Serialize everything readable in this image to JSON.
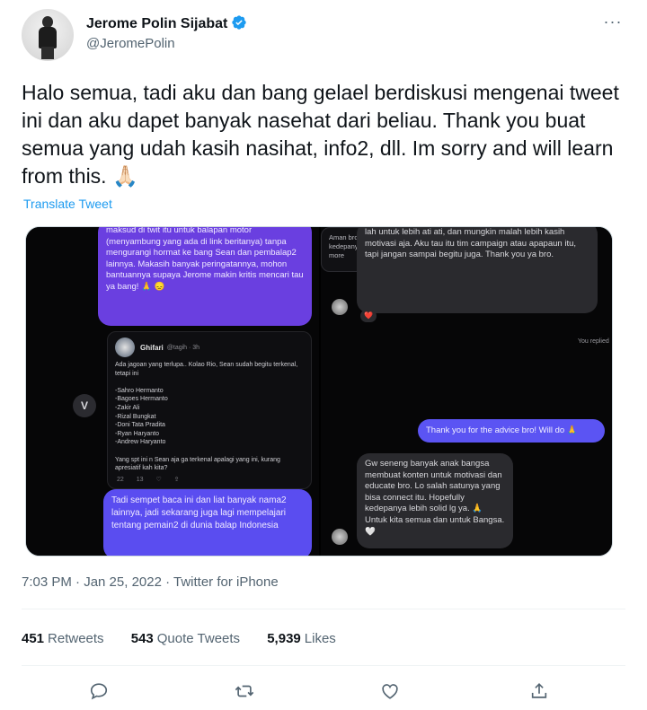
{
  "author": {
    "display_name": "Jerome Polin Sijabat",
    "handle": "@JeromePolin",
    "verified": true
  },
  "tweet": {
    "text": "Halo semua, tadi aku dan bang gelael berdiskusi mengenai tweet ini dan aku dapet banyak nasehat dari beliau. Thank you buat semua yang udah kasih nasihat, info2, dll. Im sorry and will learn from this. 🙏🏻",
    "translate_label": "Translate Tweet",
    "timestamp": "7:03 PM · Jan 25, 2022 · Twitter for iPhone"
  },
  "media": {
    "left": {
      "top_bubble": "maksud di twit itu untuk balapan motor (menyambung yang ada di link beritanya) tanpa mengurangi hormat ke bang Sean dan pembalap2 lainnya. Makasih banyak peringatannya, mohon bantuannya supaya Jerome makin kritis mencari tau ya bang! 🙏 😞",
      "v_icon_label": "V",
      "embedded_tweet": {
        "name": "Ghifari",
        "meta": "@tagih · 3h",
        "body": "Ada jagoan yang terlupa.. Kolao Rio, Sean sudah begitu terkenal, tetapi ini\n\n-Sahro Hermanto\n-Bagoes Hermanto\n-Zakir Ali\n-Rizal Bungkat\n-Doni Tata Pradita\n-Ryan Haryanto\n-Andrew Haryanto\n\nYang spt ini n Sean aja ga terkenal apalagi yang ini, kurang apresiatif kah kita?",
        "footer": "22 13 ♡ ⇪"
      },
      "bottom_bubble": "Tadi sempet baca ini dan liat banyak nama2 lainnya, jadi sekarang juga lagi mempelajari tentang pemain2 di dunia balap Indonesia"
    },
    "right": {
      "top_bubble": "lah untuk lebih ati ati, dan mungkin malah lebih kasih motivasi aja. Aku tau itu tim campaign atau apapaun itu, tapi jangan sampai begitu juga.\n\nThank you ya bro.",
      "reaction": "❤️",
      "replied_label": "You replied",
      "quoted_reply": "Aman bro, gw tau lo ga bermaksud apa apa. Tapi insyallah kedepanya sebagai orang yang di pandang banyak orang dan ... more",
      "my_bubble": "Thank you for the advice bro! Will do 🙏",
      "final_bubble": "Gw seneng banyak anak bangsa membuat konten untuk motivasi dan educate bro. Lo salah satunya yang bisa connect itu. Hopefully kedepanya lebih solid lg ya. 🙏 Untuk kita semua dan untuk Bangsa. 🤍"
    }
  },
  "stats": {
    "retweets_count": "451",
    "retweets_label": "Retweets",
    "quote_count": "543",
    "quote_label": "Quote Tweets",
    "likes_count": "5,939",
    "likes_label": "Likes"
  },
  "icons": {
    "more": "more-icon",
    "reply": "reply-icon",
    "retweet": "retweet-icon",
    "like": "like-icon",
    "share": "share-icon",
    "verified": "verified-badge-icon"
  },
  "colors": {
    "brand_blue": "#1d9bf0",
    "purple_bubble": "#6a3fe0",
    "text_primary": "#0f1419",
    "text_secondary": "#536471"
  }
}
